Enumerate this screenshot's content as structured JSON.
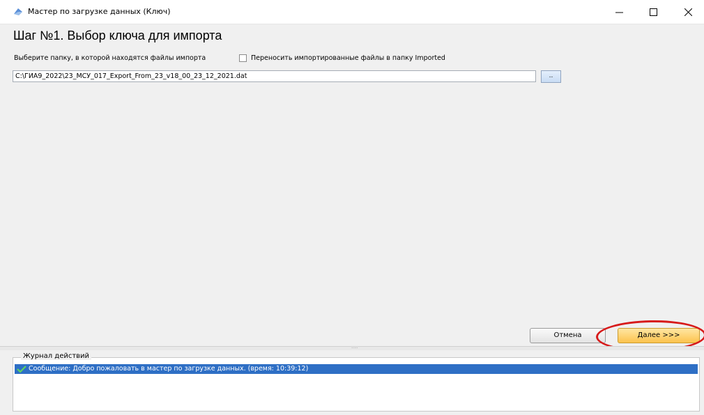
{
  "window": {
    "title": "Мастер по загрузке данных (Ключ)",
    "controls": {
      "minimize_icon": "minimize-icon",
      "maximize_icon": "maximize-icon",
      "close_icon": "close-icon"
    }
  },
  "step": {
    "title": "Шаг №1.  Выбор ключа для импорта"
  },
  "folder": {
    "label": "Выберите папку, в которой находятся файлы импорта",
    "move_checkbox_label": "Переносить импортированные файлы в папку Imported",
    "move_checked": false,
    "path_value": "C:\\ГИА9_2022\\23_МСУ_017_Export_From_23_v18_00_23_12_2021.dat",
    "browse_label": ".."
  },
  "buttons": {
    "cancel": "Отмена",
    "next": "Далее >>>"
  },
  "splitter": {
    "grip": "....."
  },
  "log": {
    "legend": "Журнал действий",
    "entries": [
      {
        "icon": "check-icon",
        "text": "Сообщение: Добро пожаловать в мастер по загрузке данных. (время: 10:39:12)"
      }
    ]
  },
  "colors": {
    "next_button": "#fcc24d",
    "log_selection": "#2e6fc5",
    "highlight_ring": "#d71a1a"
  }
}
